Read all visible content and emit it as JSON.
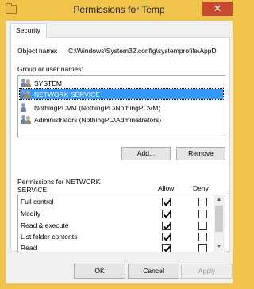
{
  "window": {
    "title": "Permissions for Temp",
    "close_glyph": "✕"
  },
  "tabs": [
    {
      "label": "Security"
    }
  ],
  "object": {
    "label": "Object name:",
    "value": "C:\\Windows\\System32\\config\\systemprofile\\AppD"
  },
  "groups": {
    "label": "Group or user names:",
    "items": [
      {
        "name": "SYSTEM",
        "selected": false
      },
      {
        "name": "NETWORK SERVICE",
        "selected": true
      },
      {
        "name": "NothingPCVM (NothingPC\\NothingPCVM)",
        "selected": false
      },
      {
        "name": "Administrators (NothingPC\\Administrators)",
        "selected": false
      }
    ],
    "add_label": "Add...",
    "remove_label": "Remove"
  },
  "permissions": {
    "label": "Permissions for NETWORK SERVICE",
    "allow_header": "Allow",
    "deny_header": "Deny",
    "items": [
      {
        "name": "Full control",
        "allow": true,
        "deny": false
      },
      {
        "name": "Modify",
        "allow": true,
        "deny": false
      },
      {
        "name": "Read & execute",
        "allow": true,
        "deny": false
      },
      {
        "name": "List folder contents",
        "allow": true,
        "deny": false
      },
      {
        "name": "Read",
        "allow": true,
        "deny": false
      },
      {
        "name": "",
        "allow": true,
        "deny": false
      }
    ]
  },
  "footer": {
    "ok_label": "OK",
    "cancel_label": "Cancel",
    "apply_label": "Apply"
  },
  "colors": {
    "title_bar": "#f0c44a",
    "selection": "#3399ff",
    "close_button": "#c7492f"
  }
}
